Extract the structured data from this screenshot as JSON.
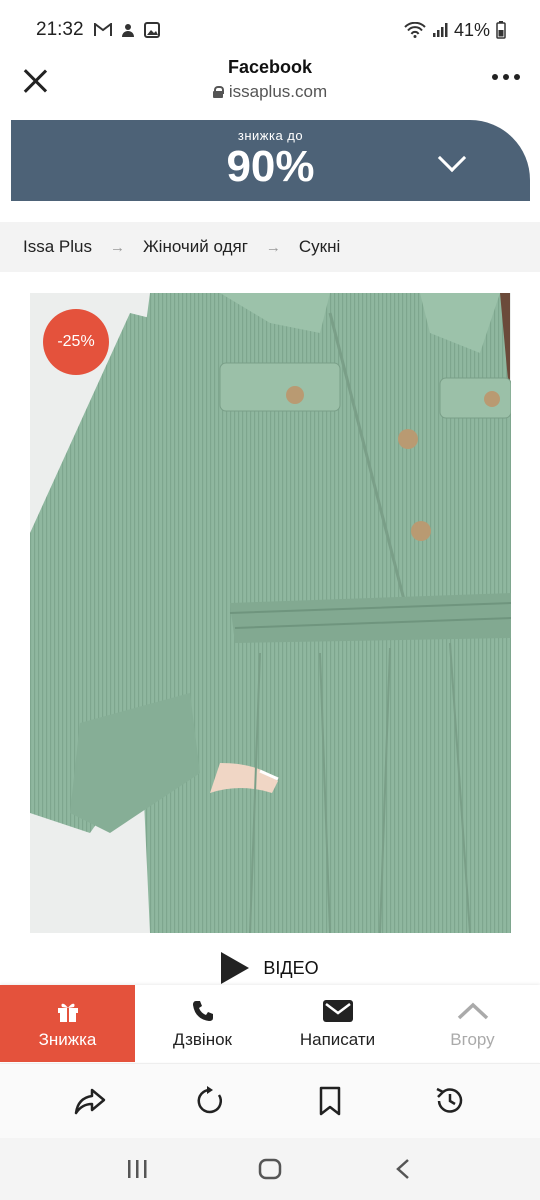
{
  "status": {
    "time": "21:32",
    "battery": "41%",
    "icons_left": [
      "gmail-icon",
      "notification-icon",
      "image-icon"
    ],
    "icons_right": [
      "wifi-icon",
      "signal-icon",
      "battery-icon"
    ]
  },
  "browser": {
    "title": "Facebook",
    "url": "issaplus.com"
  },
  "promo": {
    "small": "знижка до",
    "big": "90%",
    "bg_color": "#4d6277"
  },
  "breadcrumb": {
    "items": [
      "Issa Plus",
      "Жіночий одяг",
      "Сукні"
    ],
    "separator": "→"
  },
  "product": {
    "discount": "-25%",
    "dress_color": "#8fb79f",
    "badge_color": "#e4523c"
  },
  "video": {
    "label": "ВІДЕО"
  },
  "actions": [
    {
      "label": "Знижка",
      "icon": "gift-icon"
    },
    {
      "label": "Дзвінок",
      "icon": "phone-icon"
    },
    {
      "label": "Написати",
      "icon": "envelope-icon"
    },
    {
      "label": "Вгору",
      "icon": "chevron-up-icon"
    }
  ],
  "toolbar": {
    "icons": [
      "share-icon",
      "reload-icon",
      "bookmark-icon",
      "history-icon"
    ]
  },
  "nav": {
    "icons": [
      "recent-apps-icon",
      "home-icon",
      "back-icon"
    ]
  }
}
